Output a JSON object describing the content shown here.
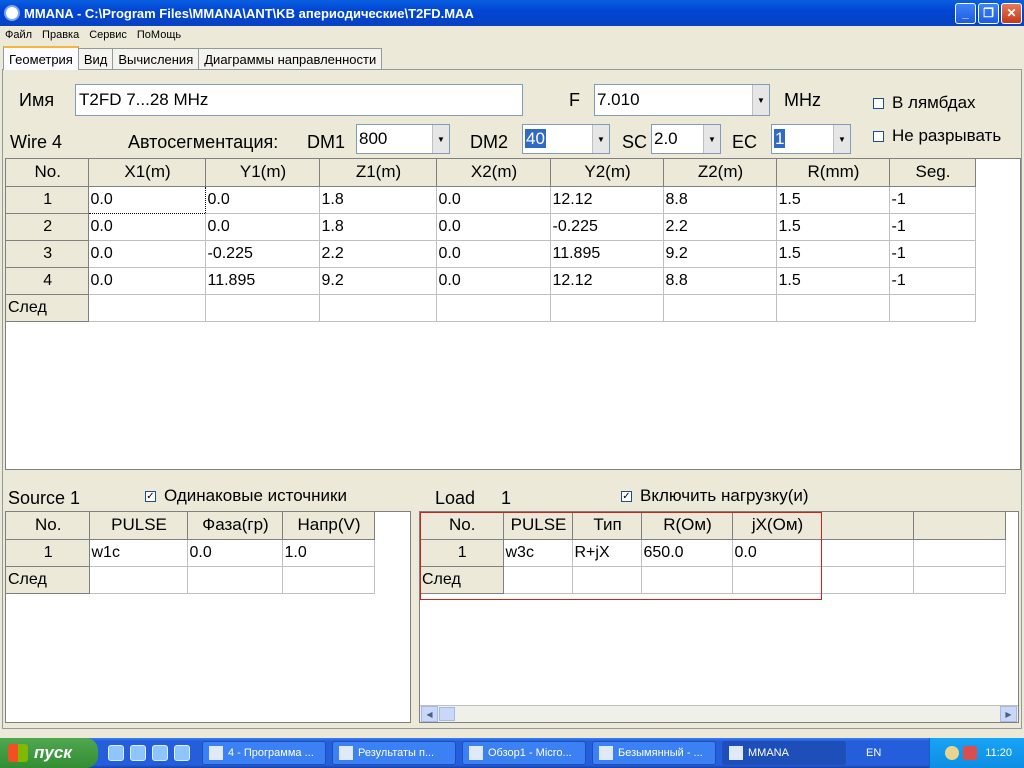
{
  "window": {
    "title": "MMANA - C:\\Program Files\\MMANA\\ANT\\KB апериодические\\T2FD.MAA",
    "min": "_",
    "max": "❐",
    "close": "✕"
  },
  "menu": [
    "Файл",
    "Правка",
    "Сервис",
    "ПоМощь"
  ],
  "tabs": [
    "Геометрия",
    "Вид",
    "Вычисления",
    "Диаграммы направленности"
  ],
  "geometry": {
    "name_label": "Имя",
    "name_value": "T2FD  7...28 MHz",
    "freq_label": "F",
    "freq_value": "7.010",
    "freq_unit": "MHz",
    "lambda_label": "В лямбдах",
    "nobreak_label": "Не разрывать",
    "wire_label": "Wire 4",
    "autoseg_label": "Автосегментация:",
    "dm1_label": "DM1",
    "dm1_value": "800",
    "dm2_label": "DM2",
    "dm2_value": "40",
    "sc_label": "SC",
    "sc_value": "2.0",
    "ec_label": "EC",
    "ec_value": "1",
    "wires": {
      "headers": [
        "No.",
        "X1(m)",
        "Y1(m)",
        "Z1(m)",
        "X2(m)",
        "Y2(m)",
        "Z2(m)",
        "R(mm)",
        "Seg."
      ],
      "rows": [
        [
          "1",
          "0.0",
          "0.0",
          "1.8",
          "0.0",
          "12.12",
          "8.8",
          "1.5",
          "-1"
        ],
        [
          "2",
          "0.0",
          "0.0",
          "1.8",
          "0.0",
          "-0.225",
          "2.2",
          "1.5",
          "-1"
        ],
        [
          "3",
          "0.0",
          "-0.225",
          "2.2",
          "0.0",
          "11.895",
          "9.2",
          "1.5",
          "-1"
        ],
        [
          "4",
          "0.0",
          "11.895",
          "9.2",
          "0.0",
          "12.12",
          "8.8",
          "1.5",
          "-1"
        ]
      ],
      "next_label": "След"
    }
  },
  "source": {
    "title": "Source 1",
    "same_label": "Одинаковые источники",
    "same_checked": "✓",
    "headers": [
      "No.",
      "PULSE",
      "Фаза(гр)",
      "Напр(V)"
    ],
    "rows": [
      [
        "1",
        "w1c",
        "0.0",
        "1.0"
      ]
    ],
    "next_label": "След"
  },
  "load": {
    "title": "Load",
    "count": "1",
    "enable_label": "Включить нагрузку(и)",
    "enable_checked": "✓",
    "headers": [
      "No.",
      "PULSE",
      "Тип",
      "R(Ом)",
      "jX(Ом)"
    ],
    "rows": [
      [
        "1",
        "w3c",
        "R+jX",
        "650.0",
        "0.0"
      ]
    ],
    "next_label": "След"
  },
  "taskbar": {
    "start": "пуск",
    "tasks": [
      "4 - Программа ...",
      "Результаты п...",
      "Обзор1 - Micro...",
      "Безымянный - ...",
      "MMANA"
    ],
    "lang": "EN",
    "time": "11:20"
  }
}
